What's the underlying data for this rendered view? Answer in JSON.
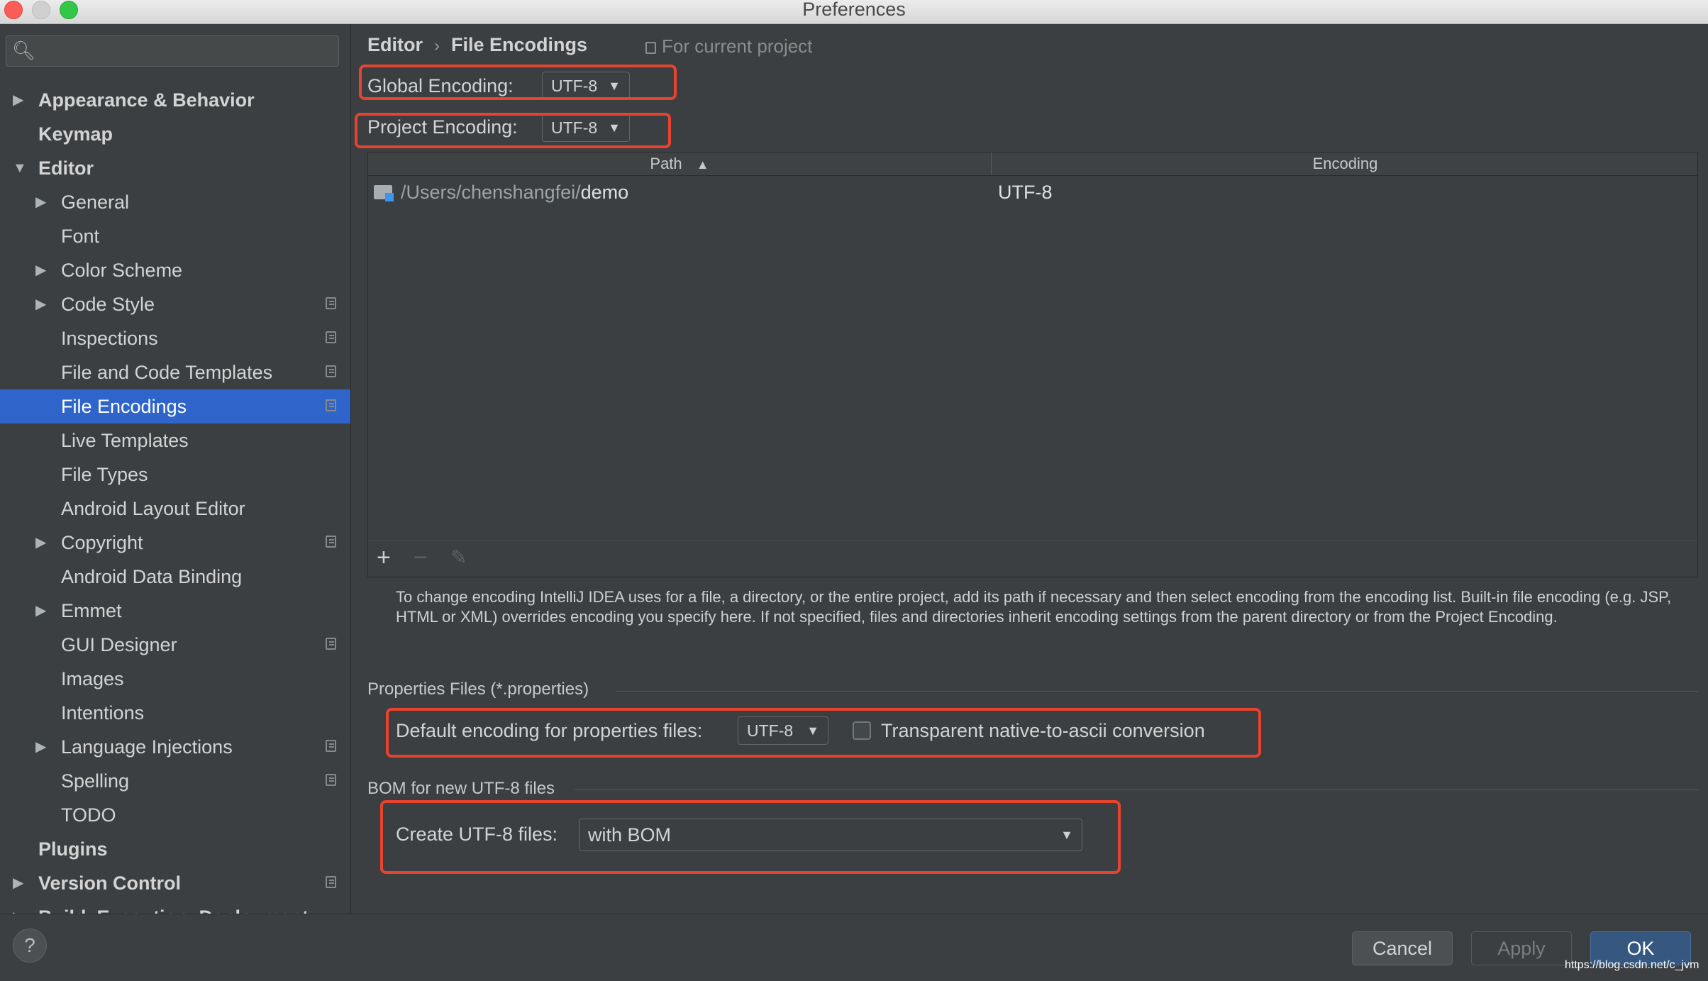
{
  "window": {
    "title": "Preferences"
  },
  "sidebar": {
    "search_placeholder": "",
    "items": [
      {
        "label": "Appearance & Behavior",
        "level": 1,
        "arrow": "▶",
        "project_icon": false
      },
      {
        "label": "Keymap",
        "level": 1,
        "arrow": "",
        "project_icon": false
      },
      {
        "label": "Editor",
        "level": 1,
        "arrow": "▼",
        "project_icon": false
      },
      {
        "label": "General",
        "level": 2,
        "arrow": "▶",
        "project_icon": false
      },
      {
        "label": "Font",
        "level": 2,
        "arrow": "",
        "project_icon": false
      },
      {
        "label": "Color Scheme",
        "level": 2,
        "arrow": "▶",
        "project_icon": false
      },
      {
        "label": "Code Style",
        "level": 2,
        "arrow": "▶",
        "project_icon": true
      },
      {
        "label": "Inspections",
        "level": 2,
        "arrow": "",
        "project_icon": true
      },
      {
        "label": "File and Code Templates",
        "level": 2,
        "arrow": "",
        "project_icon": true
      },
      {
        "label": "File Encodings",
        "level": 2,
        "arrow": "",
        "project_icon": true,
        "selected": true
      },
      {
        "label": "Live Templates",
        "level": 2,
        "arrow": "",
        "project_icon": false
      },
      {
        "label": "File Types",
        "level": 2,
        "arrow": "",
        "project_icon": false
      },
      {
        "label": "Android Layout Editor",
        "level": 2,
        "arrow": "",
        "project_icon": false
      },
      {
        "label": "Copyright",
        "level": 2,
        "arrow": "▶",
        "project_icon": true
      },
      {
        "label": "Android Data Binding",
        "level": 2,
        "arrow": "",
        "project_icon": false
      },
      {
        "label": "Emmet",
        "level": 2,
        "arrow": "▶",
        "project_icon": false
      },
      {
        "label": "GUI Designer",
        "level": 2,
        "arrow": "",
        "project_icon": true
      },
      {
        "label": "Images",
        "level": 2,
        "arrow": "",
        "project_icon": false
      },
      {
        "label": "Intentions",
        "level": 2,
        "arrow": "",
        "project_icon": false
      },
      {
        "label": "Language Injections",
        "level": 2,
        "arrow": "▶",
        "project_icon": true
      },
      {
        "label": "Spelling",
        "level": 2,
        "arrow": "",
        "project_icon": true
      },
      {
        "label": "TODO",
        "level": 2,
        "arrow": "",
        "project_icon": false
      },
      {
        "label": "Plugins",
        "level": 1,
        "arrow": "",
        "project_icon": false
      },
      {
        "label": "Version Control",
        "level": 1,
        "arrow": "▶",
        "project_icon": true
      },
      {
        "label": "Build, Execution, Deployment",
        "level": 1,
        "arrow": "▶",
        "project_icon": false,
        "partial": true
      }
    ]
  },
  "breadcrumb": {
    "parent": "Editor",
    "separator": "›",
    "current": "File Encodings",
    "scope": "For current project"
  },
  "global_encoding": {
    "label": "Global Encoding:",
    "value": "UTF-8"
  },
  "project_encoding": {
    "label": "Project Encoding:",
    "value": "UTF-8"
  },
  "table": {
    "columns": {
      "path": "Path",
      "sort_indicator": "▲",
      "encoding": "Encoding"
    },
    "rows": [
      {
        "path_prefix": "/Users/chenshangfei/",
        "path_name": "demo",
        "encoding": "UTF-8"
      }
    ],
    "toolbar": {
      "add": "+",
      "remove": "−",
      "edit": "✎"
    }
  },
  "help_text": "To change encoding IntelliJ IDEA uses for a file, a directory, or the entire project, add its path if necessary and then select encoding from the encoding list. Built-in file encoding (e.g. JSP, HTML or XML) overrides encoding you specify here. If not specified, files and directories inherit encoding settings from the parent directory or from the Project Encoding.",
  "properties": {
    "section_title": "Properties Files (*.properties)",
    "default_label": "Default encoding for properties files:",
    "default_value": "UTF-8",
    "transparent_label": "Transparent native-to-ascii conversion",
    "transparent_checked": false
  },
  "bom": {
    "section_title": "BOM for new UTF-8 files",
    "create_label": "Create UTF-8 files:",
    "create_value": "with BOM"
  },
  "buttons": {
    "help": "?",
    "cancel": "Cancel",
    "apply": "Apply",
    "ok": "OK"
  },
  "watermark": "https://blog.csdn.net/c_jvm",
  "colors": {
    "highlight_box": "#e8432f",
    "selection": "#2f65ca",
    "ok_button": "#365880"
  }
}
